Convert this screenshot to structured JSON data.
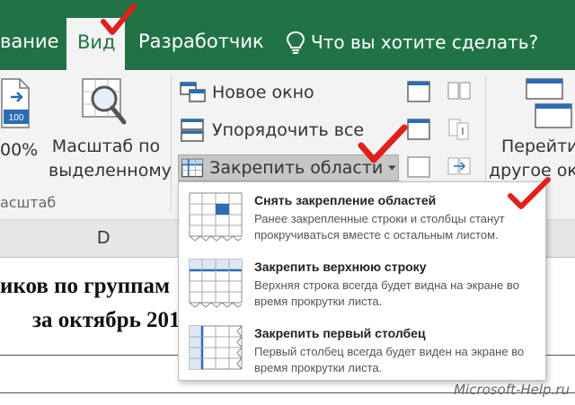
{
  "tabs": {
    "view_partial": "вание",
    "view": "Вид",
    "developer": "Разработчик",
    "tell_me": "Что вы хотите сделать?"
  },
  "ribbon": {
    "zoom_100_partial": "00%",
    "zoom_100_icon_text": "100",
    "zoom_selection_line1": "Масштаб по",
    "zoom_selection_line2": "выделенному",
    "group_zoom_label": "асштаб",
    "new_window": "Новое окно",
    "arrange_all": "Упорядочить все",
    "freeze_panes": "Закрепить области",
    "goto_line1": "Перейти",
    "goto_line2": "другое ок"
  },
  "sheet": {
    "column_d": "D",
    "line1": "иков по группам",
    "line2": "за октябрь 201"
  },
  "menu": {
    "items": [
      {
        "title": "Снять закрепление областей",
        "description": "Ранее закрепленные строки и столбцы станут прокручиваться вместе с остальным листом."
      },
      {
        "title": "Закрепить верхнюю строку",
        "description": "Верхняя строка всегда будет видна на экране во время прокрутки листа."
      },
      {
        "title": "Закрепить первый столбец",
        "description": "Первый столбец всегда будет виден на экране во время прокрутки листа."
      }
    ]
  },
  "watermark": "Microsoft-Help.ru",
  "colors": {
    "excel_green": "#217346",
    "ribbon_bg": "#f3f3f3",
    "check_red": "#e0201a",
    "icon_blue": "#2b6cb5"
  }
}
